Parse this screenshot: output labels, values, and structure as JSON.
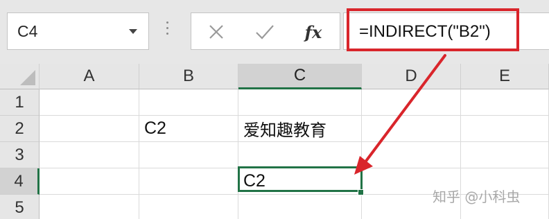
{
  "name_box": {
    "value": "C4"
  },
  "formula": {
    "text": "=INDIRECT(\"B2\")"
  },
  "icons": {
    "cancel": "cancel-x-icon",
    "enter": "checkmark-icon",
    "insert_function": "fx-icon",
    "fx_glyph": "fx"
  },
  "columns": [
    "A",
    "B",
    "C",
    "D",
    "E"
  ],
  "rows": [
    "1",
    "2",
    "3",
    "4",
    "5"
  ],
  "active_cell": "C4",
  "cells": {
    "B2": "C2",
    "C2": "爱知趣教育",
    "C4": "C2"
  },
  "annotation": {
    "highlight_color": "#d9252b"
  },
  "accent_color": "#217346",
  "watermark": "知乎 @小科虫"
}
